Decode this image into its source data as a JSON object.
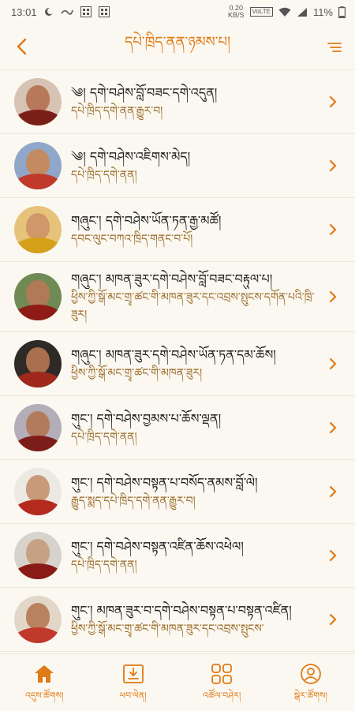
{
  "status_bar": {
    "time": "13:01",
    "net_speed_value": "0.20",
    "net_speed_unit": "KB/S",
    "volte": "VoLTE",
    "battery": "11%"
  },
  "header": {
    "title": "དཔེ་ཁྲིད་ནན་ཉམས་པ།"
  },
  "colors": {
    "accent": "#e07a16",
    "background": "#fbf8f1",
    "name_text": "#1a1a1a",
    "sub_text": "#9a6a28"
  },
  "list": [
    {
      "name": "༄། དགེ་བཤེས་བློ་བཟང་དགེ་འདུན།",
      "sub": "དཔེ་ཁྲིད་དགེ་ནན་རྒྱུར་བ།",
      "face": "#b8785a",
      "robe": "#7a1f18",
      "bg": "#d6c3b3"
    },
    {
      "name": "༄། དགེ་བཤེས་འཇིགས་མེད།",
      "sub": "དཔེ་ཁྲིད་དགེ་ནན།",
      "face": "#c48a62",
      "robe": "#c0392b",
      "bg": "#8fa8c9"
    },
    {
      "name": "གཞུང་། དགེ་བཤེས་ཡོན་ཏན་རྒྱ་མཚོ།",
      "sub": "དབང་ལུང་བཀའ་ཁྲིད་གནང་བ་པོ།",
      "face": "#d0976a",
      "robe": "#d4a017",
      "bg": "#e6c27a"
    },
    {
      "name": "གཞུང་། མཁན་ཟུར་དགེ་བཤེས་བློ་བཟང་བརྟུལ་པ།",
      "sub": "ཕྱིས་ཀྱི་སྒོ་མང་གྲྭ་ཚང་གི་མཁན་ཟུར་དང་འབྲས་སྤུངས་དགོན་པའི་ཁྲི་ཟུར།",
      "face": "#b07a56",
      "robe": "#8e1b16",
      "bg": "#6f8a55"
    },
    {
      "name": "གཞུང་། མཁན་ཟུར་དགེ་བཤེས་ཡོན་ཏན་དམ་ཆོས།",
      "sub": "ཕྱིས་ཀྱི་སྒོ་མང་གྲྭ་ཚང་གི་མཁན་ཟུར།",
      "face": "#a8704e",
      "robe": "#a0281c",
      "bg": "#2e2a26"
    },
    {
      "name": "གུང་། དགེ་བཤེས་བྱམས་པ་ཆོས་ལྡན།",
      "sub": "དཔེ་ཁྲིད་དགེ་ནན།",
      "face": "#b27c5c",
      "robe": "#7d1d1a",
      "bg": "#b3aeb8"
    },
    {
      "name": "གུང་། དགེ་བཤེས་བསྟན་པ་བསོད་ནམས་བློ་ལེ།",
      "sub": "རྒྱུད་སྨད་དཔེ་ཁྲིད་དགེ་ནན་རྒྱུར་བ།",
      "face": "#c99a7a",
      "robe": "#b52a1e",
      "bg": "#ece9e3"
    },
    {
      "name": "གུང་། དགེ་བཤེས་བསྟན་འཛིན་ཆོས་འཕེལ།",
      "sub": "དཔེ་ཁྲིད་དགེ་ནན།",
      "face": "#c7a184",
      "robe": "#8a1a16",
      "bg": "#d8d2cc"
    },
    {
      "name": "གུང་། མཁན་ཟུར་བ་དགེ་བཤེས་བསྟན་པ་བསྟན་འཛིན།",
      "sub": "ཕྱིས་ཀྱི་སྒོ་མང་གྲྭ་ཚང་གི་མཁན་ཟུར་དང་འབྲས་སྤུངས་",
      "face": "#b8825e",
      "robe": "#c0392b",
      "bg": "#e2d6c8"
    }
  ],
  "bottom_nav": [
    {
      "label": "འདུས་ཚོགས།",
      "icon": "home-icon"
    },
    {
      "label": "ཕབ་ལེན།",
      "icon": "download-icon"
    },
    {
      "label": "འཚོལ་བཤེར།",
      "icon": "grid-icon"
    },
    {
      "label": "སྒེར་ཚོགས།",
      "icon": "profile-icon"
    }
  ]
}
